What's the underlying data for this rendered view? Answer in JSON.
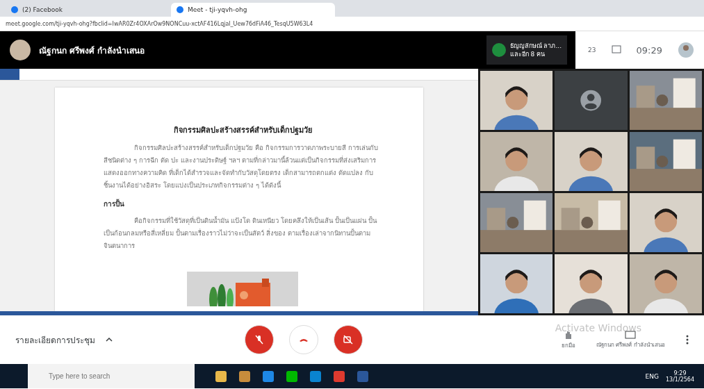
{
  "browser": {
    "tabs": [
      {
        "title": "(2) Facebook",
        "selected": false
      },
      {
        "title": "Meet - tji-yqvh-ohg",
        "selected": true
      }
    ],
    "url": "meet.google.com/tji-yqvh-ohg?fbclid=IwAR0Zr4OXArOw9NONCuu-xctAF416Lqjal_Uew76dFiA46_TesqU5W63L4"
  },
  "meet_bar": {
    "presenter": "ณัฐกนก ศรีพงศ์ กำลังนำเสนอ",
    "participant_name": "ธัญญลักษณ์ ลาภ...",
    "participant_more": "และอีก 8 คน",
    "people_count": "23",
    "time": "09:29"
  },
  "document": {
    "title": "กิจกรรมศิลปะสร้างสรรค์สำหรับเด็กปฐมวัย",
    "paragraph_1": "กิจกรรมศิลปะสร้างสรรค์สำหรับเด็กปฐมวัย คือ กิจกรรมการวาดภาพระบายสี การเล่นกับสีชนิดต่าง ๆ การฉีก ตัด ปะ และงานประดิษฐ์ ฯลฯ ตามที่กล่าวมานี้ล้วนแต่เป็นกิจกรรมที่ส่งเสริมการแสดงออกทางความคิด ที่เด็กได้สำรวจและจัดทำกับวัสดุโดยตรง เด็กสามารถตกแต่ง ดัดแปลง กับชิ้นงานได้อย่างอิสระ โดยแบ่งเป็นประเภทกิจกรรมต่าง ๆ ได้ดังนี้",
    "heading": "การปั้น",
    "paragraph_2": "คือกิจกรรมที่ใช้วัสดุที่เป็นดินน้ำมัน แป้งโด ดินเหนียว โดยคลึงให้เป็นเส้น ปั้นเป็นแผ่น ปั้นเป็นก้อนกลมหรือสี่เหลี่ยม ปั้นตามเรื่องราวไม่ว่าจะเป็นสัตว์ สิ่งของ ตามเรื่องเล่าจากนิทานปั้นตามจินตนาการ",
    "image": {
      "kind": "picture"
    }
  },
  "tiles": [
    {
      "kind": "person"
    },
    {
      "kind": "avatar"
    },
    {
      "kind": "picture"
    },
    {
      "kind": "person"
    },
    {
      "kind": "person"
    },
    {
      "kind": "picture"
    },
    {
      "kind": "picture"
    },
    {
      "kind": "picture"
    },
    {
      "kind": "person"
    },
    {
      "kind": "person"
    },
    {
      "kind": "person"
    },
    {
      "kind": "person"
    }
  ],
  "controls": {
    "meeting_details": "รายละเอียดการประชุม",
    "mic_on": false,
    "camera_on": false,
    "raise_hand": "ยกมือ",
    "presenting_label": "ณัฐกนก ศรีพงศ์ กำลังนำเสนอ",
    "activate_notice": "Activate Windows"
  },
  "taskbar": {
    "search_placeholder": "Type here to search",
    "language": "ENG",
    "time": "9:29",
    "date": "13/1/2564"
  }
}
